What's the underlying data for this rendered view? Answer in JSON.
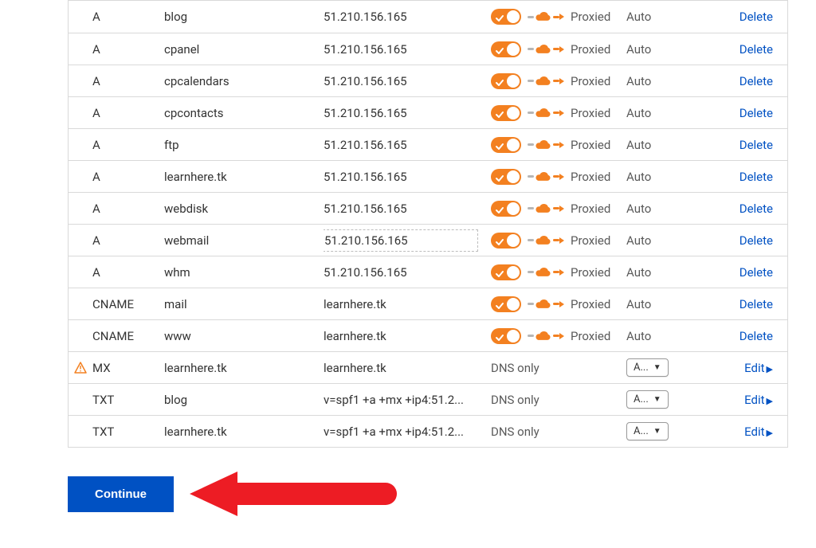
{
  "dns": {
    "rows": [
      {
        "warn": false,
        "type": "A",
        "name": "blog",
        "content": "51.210.156.165",
        "proxy": "proxied",
        "proxy_label": "Proxied",
        "ttl": "Auto",
        "action": "Delete",
        "action_kind": "delete",
        "editable": false
      },
      {
        "warn": false,
        "type": "A",
        "name": "cpanel",
        "content": "51.210.156.165",
        "proxy": "proxied",
        "proxy_label": "Proxied",
        "ttl": "Auto",
        "action": "Delete",
        "action_kind": "delete",
        "editable": false
      },
      {
        "warn": false,
        "type": "A",
        "name": "cpcalendars",
        "content": "51.210.156.165",
        "proxy": "proxied",
        "proxy_label": "Proxied",
        "ttl": "Auto",
        "action": "Delete",
        "action_kind": "delete",
        "editable": false
      },
      {
        "warn": false,
        "type": "A",
        "name": "cpcontacts",
        "content": "51.210.156.165",
        "proxy": "proxied",
        "proxy_label": "Proxied",
        "ttl": "Auto",
        "action": "Delete",
        "action_kind": "delete",
        "editable": false
      },
      {
        "warn": false,
        "type": "A",
        "name": "ftp",
        "content": "51.210.156.165",
        "proxy": "proxied",
        "proxy_label": "Proxied",
        "ttl": "Auto",
        "action": "Delete",
        "action_kind": "delete",
        "editable": false
      },
      {
        "warn": false,
        "type": "A",
        "name": "learnhere.tk",
        "content": "51.210.156.165",
        "proxy": "proxied",
        "proxy_label": "Proxied",
        "ttl": "Auto",
        "action": "Delete",
        "action_kind": "delete",
        "editable": false
      },
      {
        "warn": false,
        "type": "A",
        "name": "webdisk",
        "content": "51.210.156.165",
        "proxy": "proxied",
        "proxy_label": "Proxied",
        "ttl": "Auto",
        "action": "Delete",
        "action_kind": "delete",
        "editable": false
      },
      {
        "warn": false,
        "type": "A",
        "name": "webmail",
        "content": "51.210.156.165",
        "proxy": "proxied",
        "proxy_label": "Proxied",
        "ttl": "Auto",
        "action": "Delete",
        "action_kind": "delete",
        "editable": true
      },
      {
        "warn": false,
        "type": "A",
        "name": "whm",
        "content": "51.210.156.165",
        "proxy": "proxied",
        "proxy_label": "Proxied",
        "ttl": "Auto",
        "action": "Delete",
        "action_kind": "delete",
        "editable": false
      },
      {
        "warn": false,
        "type": "CNAME",
        "name": "mail",
        "content": "learnhere.tk",
        "proxy": "proxied",
        "proxy_label": "Proxied",
        "ttl": "Auto",
        "action": "Delete",
        "action_kind": "delete",
        "editable": false
      },
      {
        "warn": false,
        "type": "CNAME",
        "name": "www",
        "content": "learnhere.tk",
        "proxy": "proxied",
        "proxy_label": "Proxied",
        "ttl": "Auto",
        "action": "Delete",
        "action_kind": "delete",
        "editable": false
      },
      {
        "warn": true,
        "type": "MX",
        "name": "learnhere.tk",
        "content": "learnhere.tk",
        "proxy": "dns_only",
        "proxy_label": "DNS only",
        "ttl": "A...",
        "action": "Edit",
        "action_kind": "edit",
        "editable": false
      },
      {
        "warn": false,
        "type": "TXT",
        "name": "blog",
        "content": "v=spf1 +a +mx +ip4:51.2...",
        "proxy": "dns_only",
        "proxy_label": "DNS only",
        "ttl": "A...",
        "action": "Edit",
        "action_kind": "edit",
        "editable": false
      },
      {
        "warn": false,
        "type": "TXT",
        "name": "learnhere.tk",
        "content": "v=spf1 +a +mx +ip4:51.2...",
        "proxy": "dns_only",
        "proxy_label": "DNS only",
        "ttl": "A...",
        "action": "Edit",
        "action_kind": "edit",
        "editable": false
      }
    ]
  },
  "buttons": {
    "continue": "Continue"
  },
  "colors": {
    "brand_orange": "#f38020",
    "brand_blue": "#0051c3",
    "annotation_red": "#ed1c24"
  }
}
